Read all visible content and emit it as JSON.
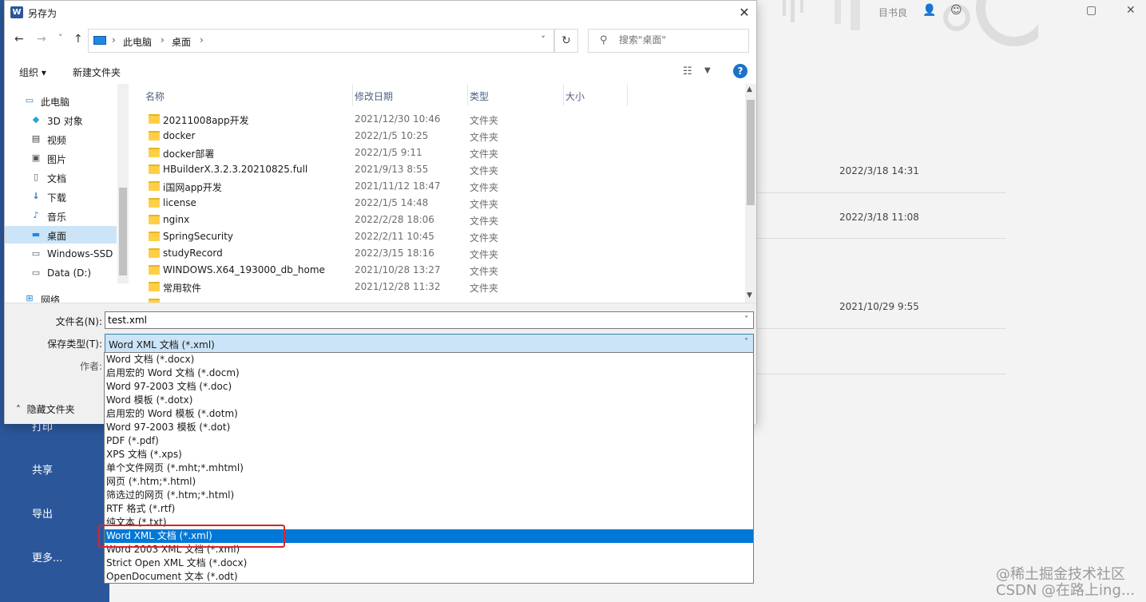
{
  "window": {
    "title": "另存为",
    "close_glyph": "✕"
  },
  "navigation": {
    "back_glyph": "←",
    "forward_glyph": "→",
    "recent_glyph": "˅",
    "up_glyph": "↑",
    "breadcrumbs": [
      "此电脑",
      "桌面"
    ],
    "search_placeholder": "搜索\"桌面\""
  },
  "toolbar": {
    "organize_label": "组织 ▾",
    "new_folder_label": "新建文件夹"
  },
  "sidebar": {
    "items": [
      {
        "label": "此电脑",
        "icon": "computer-icon"
      },
      {
        "label": "3D 对象",
        "icon": "cube-icon"
      },
      {
        "label": "视频",
        "icon": "video-icon"
      },
      {
        "label": "图片",
        "icon": "picture-icon"
      },
      {
        "label": "文档",
        "icon": "document-icon"
      },
      {
        "label": "下载",
        "icon": "download-icon"
      },
      {
        "label": "音乐",
        "icon": "music-icon"
      },
      {
        "label": "桌面",
        "icon": "desktop-icon",
        "selected": true
      },
      {
        "label": "Windows-SSD",
        "icon": "drive-icon"
      },
      {
        "label": "Data (D:)",
        "icon": "drive-icon"
      },
      {
        "label": "网络",
        "icon": "network-icon"
      }
    ]
  },
  "file_list": {
    "columns": [
      "名称",
      "修改日期",
      "类型",
      "大小"
    ],
    "rows": [
      {
        "name": "20211008app开发",
        "date": "2021/12/30 10:46",
        "type": "文件夹"
      },
      {
        "name": "docker",
        "date": "2022/1/5 10:25",
        "type": "文件夹"
      },
      {
        "name": "docker部署",
        "date": "2022/1/5 9:11",
        "type": "文件夹"
      },
      {
        "name": "HBuilderX.3.2.3.20210825.full",
        "date": "2021/9/13 8:55",
        "type": "文件夹"
      },
      {
        "name": "i国网app开发",
        "date": "2021/11/12 18:47",
        "type": "文件夹"
      },
      {
        "name": "license",
        "date": "2022/1/5 14:48",
        "type": "文件夹"
      },
      {
        "name": "nginx",
        "date": "2022/2/28 18:06",
        "type": "文件夹"
      },
      {
        "name": "SpringSecurity",
        "date": "2022/2/11 10:45",
        "type": "文件夹"
      },
      {
        "name": "studyRecord",
        "date": "2022/3/15 18:16",
        "type": "文件夹"
      },
      {
        "name": "WINDOWS.X64_193000_db_home",
        "date": "2021/10/28 13:27",
        "type": "文件夹"
      },
      {
        "name": "常用软件",
        "date": "2021/12/28 11:32",
        "type": "文件夹"
      }
    ]
  },
  "form": {
    "filename_label": "文件名(N):",
    "filename_value": "test.xml",
    "filetype_label": "保存类型(T):",
    "filetype_value": "Word XML 文档 (*.xml)",
    "author_label": "作者:",
    "hide_folders_label": "隐藏文件夹"
  },
  "file_types": [
    "Word 文档 (*.docx)",
    "启用宏的 Word 文档 (*.docm)",
    "Word 97-2003 文档 (*.doc)",
    "Word 模板 (*.dotx)",
    "启用宏的 Word 模板 (*.dotm)",
    "Word 97-2003 模板 (*.dot)",
    "PDF (*.pdf)",
    "XPS 文档 (*.xps)",
    "单个文件网页 (*.mht;*.mhtml)",
    "网页 (*.htm;*.html)",
    "筛选过的网页 (*.htm;*.html)",
    "RTF 格式 (*.rtf)",
    "纯文本 (*.txt)",
    "Word XML 文档 (*.xml)",
    "Word 2003 XML 文档 (*.xml)",
    "Strict Open XML 文档 (*.docx)",
    "OpenDocument 文本 (*.odt)"
  ],
  "selected_file_type_index": 13,
  "background": {
    "user_label": "目书良",
    "nav_items": [
      "打印",
      "共享",
      "导出",
      "更多..."
    ],
    "dates": [
      "2022/3/18 14:31",
      "2022/3/18 11:08",
      "2021/10/29 9:55"
    ]
  },
  "watermark": {
    "line1": "@稀土掘金技术社区",
    "line2": "CSDN @在路上ing..."
  },
  "colors": {
    "word_blue": "#2b579a",
    "selection_blue": "#0078d7",
    "highlight_red": "#e0222a"
  }
}
